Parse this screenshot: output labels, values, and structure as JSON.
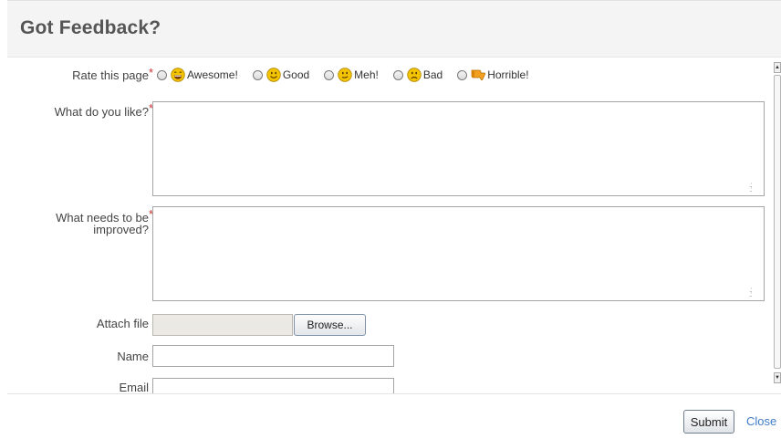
{
  "dialog": {
    "title": "Got Feedback?"
  },
  "form": {
    "rating": {
      "label": "Rate this page",
      "required_mark": "*",
      "options": [
        {
          "label": "Awesome!",
          "icon": "laughing-face-icon",
          "selected": false
        },
        {
          "label": "Good",
          "icon": "smiling-face-icon",
          "selected": false
        },
        {
          "label": "Meh!",
          "icon": "meh-face-icon",
          "selected": false
        },
        {
          "label": "Bad",
          "icon": "sad-face-icon",
          "selected": false
        },
        {
          "label": "Horrible!",
          "icon": "thumbs-down-icon",
          "selected": false
        }
      ]
    },
    "like": {
      "label": "What do you like?",
      "required_mark": "*",
      "value": ""
    },
    "improve": {
      "label_line1": "What needs to be",
      "label_line2": "improved?",
      "required_mark": "*",
      "value": ""
    },
    "attach": {
      "label": "Attach file",
      "browse_label": "Browse..."
    },
    "name": {
      "label": "Name",
      "value": ""
    },
    "email": {
      "label": "Email",
      "value": ""
    }
  },
  "footer": {
    "submit_label": "Submit",
    "close_label": "Close"
  },
  "colors": {
    "required": "#c83232",
    "link": "#3d7cc9",
    "smiley": "#f5c400",
    "thumb": "#f3a020"
  }
}
